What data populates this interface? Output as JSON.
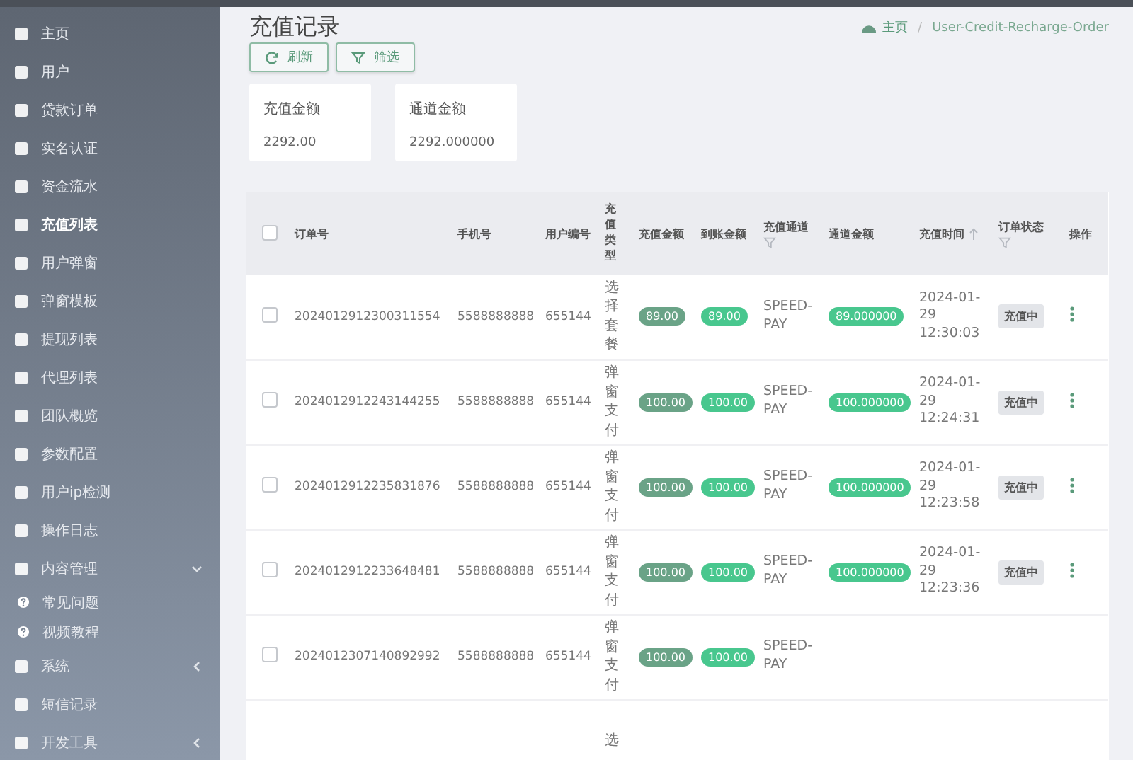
{
  "sidebar": {
    "items": [
      {
        "label": "主页",
        "selected": false
      },
      {
        "label": "用户",
        "selected": false
      },
      {
        "label": "贷款订单",
        "selected": false
      },
      {
        "label": "实名认证",
        "selected": false
      },
      {
        "label": "资金流水",
        "selected": false
      },
      {
        "label": "充值列表",
        "selected": true
      },
      {
        "label": "用户弹窗",
        "selected": false
      },
      {
        "label": "弹窗模板",
        "selected": false
      },
      {
        "label": "提现列表",
        "selected": false
      },
      {
        "label": "代理列表",
        "selected": false
      },
      {
        "label": "团队概览",
        "selected": false
      },
      {
        "label": "参数配置",
        "selected": false
      },
      {
        "label": "用户ip检测",
        "selected": false
      },
      {
        "label": "操作日志",
        "selected": false
      },
      {
        "label": "内容管理",
        "selected": false,
        "expanded": true,
        "children": [
          {
            "label": "常见问题",
            "selected": false
          },
          {
            "label": "视频教程",
            "selected": false
          }
        ]
      },
      {
        "label": "系统",
        "selected": false,
        "expanded": false
      },
      {
        "label": "短信记录",
        "selected": false
      },
      {
        "label": "开发工具",
        "selected": false,
        "expanded": false
      }
    ]
  },
  "page": {
    "title": "充值记录",
    "breadcrumb": [
      "主页",
      "User-Credit-Recharge-Order"
    ],
    "breadcrumb_separator": "/"
  },
  "toolbar": {
    "buttons": [
      "刷新",
      "筛选"
    ]
  },
  "stats": [
    {
      "label": "充值金额",
      "value": "2292.00"
    },
    {
      "label": "通道金额",
      "value": "2292.000000"
    }
  ],
  "table": {
    "select_all": {
      "checked": false
    },
    "columns": [
      {
        "label": "订单号"
      },
      {
        "label": "手机号"
      },
      {
        "label": "用户编号"
      },
      {
        "label": "充值类型",
        "vertical": true
      },
      {
        "label": "充值金额"
      },
      {
        "label": "到账金额"
      },
      {
        "label": "充值通道",
        "filter": true
      },
      {
        "label": "通道金额"
      },
      {
        "label": "充值时间",
        "sort": true
      },
      {
        "label": "订单状态",
        "filter": true
      },
      {
        "label": "操作"
      }
    ],
    "rows": [
      {
        "checked": false,
        "order": "2024012912300311554",
        "phone": "5588888888",
        "user_id": "655144",
        "type": "选择套餐",
        "amount": "89.00",
        "arrival": "89.00",
        "channel": "SPEED-PAY",
        "channel_amount": "89.000000",
        "time": "2024-01-29 12:30:03",
        "status": "充值中"
      },
      {
        "checked": false,
        "order": "2024012912243144255",
        "phone": "5588888888",
        "user_id": "655144",
        "type": "弹窗支付",
        "amount": "100.00",
        "arrival": "100.00",
        "channel": "SPEED-PAY",
        "channel_amount": "100.000000",
        "time": "2024-01-29 12:24:31",
        "status": "充值中"
      },
      {
        "checked": false,
        "order": "2024012912235831876",
        "phone": "5588888888",
        "user_id": "655144",
        "type": "弹窗支付",
        "amount": "100.00",
        "arrival": "100.00",
        "channel": "SPEED-PAY",
        "channel_amount": "100.000000",
        "time": "2024-01-29 12:23:58",
        "status": "充值中"
      },
      {
        "checked": false,
        "order": "2024012912233648481",
        "phone": "5588888888",
        "user_id": "655144",
        "type": "弹窗支付",
        "amount": "100.00",
        "arrival": "100.00",
        "channel": "SPEED-PAY",
        "channel_amount": "100.000000",
        "time": "2024-01-29 12:23:36",
        "status": "充值中"
      },
      {
        "checked": false,
        "order": "2024012307140892992",
        "phone": "5588888888",
        "user_id": "655144",
        "type": "弹窗支付",
        "amount": "100.00",
        "arrival": "100.00",
        "channel": "SPEED-PAY"
      },
      {
        "type": "选"
      }
    ]
  }
}
